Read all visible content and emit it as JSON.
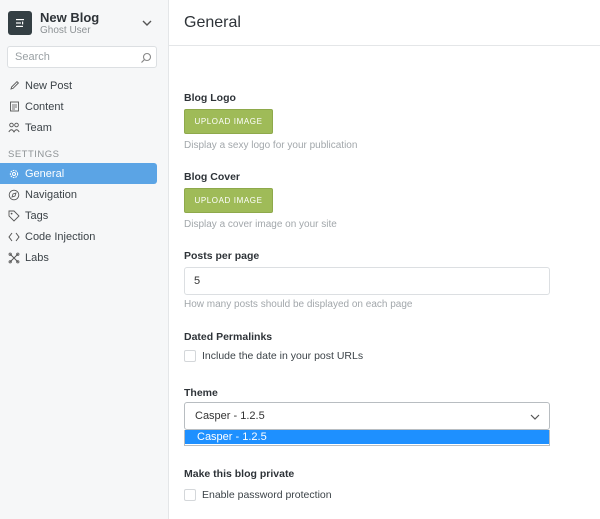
{
  "blog": {
    "title": "New Blog",
    "user": "Ghost User"
  },
  "search": {
    "placeholder": "Search"
  },
  "nav": {
    "items": [
      {
        "label": "New Post",
        "icon": "pencil-icon"
      },
      {
        "label": "Content",
        "icon": "document-icon"
      },
      {
        "label": "Team",
        "icon": "users-icon"
      }
    ],
    "section_label": "SETTINGS",
    "settings": [
      {
        "label": "General",
        "icon": "gear-icon",
        "active": true
      },
      {
        "label": "Navigation",
        "icon": "compass-icon"
      },
      {
        "label": "Tags",
        "icon": "tag-icon"
      },
      {
        "label": "Code Injection",
        "icon": "code-icon"
      },
      {
        "label": "Labs",
        "icon": "labs-icon"
      }
    ]
  },
  "page": {
    "title": "General"
  },
  "logo": {
    "label": "Blog Logo",
    "button": "UPLOAD IMAGE",
    "hint": "Display a sexy logo for your publication"
  },
  "cover": {
    "label": "Blog Cover",
    "button": "UPLOAD IMAGE",
    "hint": "Display a cover image on your site"
  },
  "posts_per_page": {
    "label": "Posts per page",
    "value": "5",
    "hint": "How many posts should be displayed on each page"
  },
  "permalinks": {
    "label": "Dated Permalinks",
    "checkbox": "Include the date in your post URLs",
    "checked": false
  },
  "theme": {
    "label": "Theme",
    "selected": "Casper - 1.2.5",
    "options": [
      "Casper - 1.2.5"
    ]
  },
  "private": {
    "label": "Make this blog private",
    "checkbox": "Enable password protection",
    "checked": false
  },
  "colors": {
    "accent": "#5ba4e5",
    "upload_button": "#9fbb58",
    "dropdown_highlight": "#1e90ff"
  }
}
